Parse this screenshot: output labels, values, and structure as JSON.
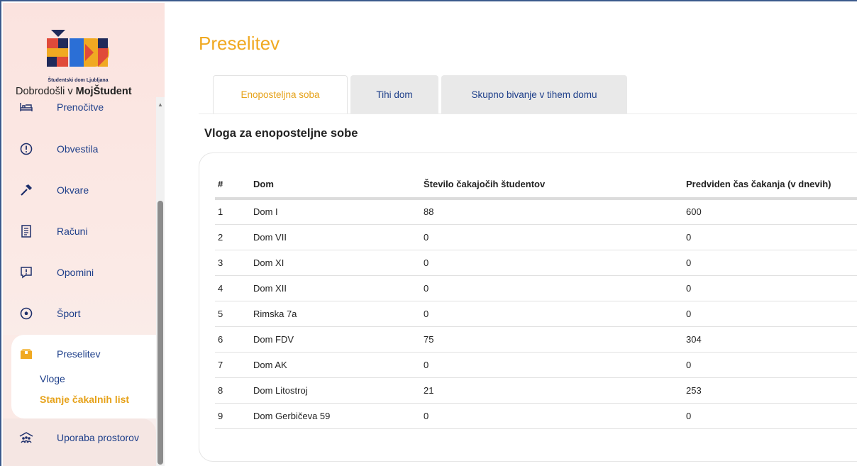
{
  "brand": {
    "caption": "Študentski dom Ljubljana",
    "colors": {
      "navy": "#1f2a5a",
      "red": "#e04a3a",
      "orange": "#f0a922",
      "blue": "#2b6fd6"
    }
  },
  "sidebar": {
    "welcome_prefix": "Dobrodošli v ",
    "welcome_app": "MojŠtudent",
    "items": [
      {
        "label": "Prenočitve",
        "icon": "bed-icon"
      },
      {
        "label": "Obvestila",
        "icon": "alert-circle-icon"
      },
      {
        "label": "Okvare",
        "icon": "hammer-icon"
      },
      {
        "label": "Računi",
        "icon": "receipt-icon"
      },
      {
        "label": "Opomini",
        "icon": "alert-message-icon"
      },
      {
        "label": "Šport",
        "icon": "soccer-ball-icon"
      },
      {
        "label": "Preselitev",
        "icon": "box-icon"
      },
      {
        "label": "Uporaba prostorov",
        "icon": "group-icon"
      }
    ],
    "sub_items": [
      {
        "label": "Vloge"
      },
      {
        "label": "Stanje čakalnih list"
      }
    ]
  },
  "main": {
    "title": "Preselitev",
    "tabs": [
      {
        "label": "Enoposteljna soba",
        "active": true
      },
      {
        "label": "Tihi dom",
        "active": false
      },
      {
        "label": "Skupno bivanje v tihem domu",
        "active": false
      }
    ],
    "section_title": "Vloga za enoposteljne sobe",
    "table": {
      "headers": [
        "#",
        "Dom",
        "Število čakajočih študentov",
        "Predviden čas čakanja (v dnevih)"
      ],
      "rows": [
        [
          "1",
          "Dom I",
          "88",
          "600"
        ],
        [
          "2",
          "Dom VII",
          "0",
          "0"
        ],
        [
          "3",
          "Dom XI",
          "0",
          "0"
        ],
        [
          "4",
          "Dom XII",
          "0",
          "0"
        ],
        [
          "5",
          "Rimska 7a",
          "0",
          "0"
        ],
        [
          "6",
          "Dom FDV",
          "75",
          "304"
        ],
        [
          "7",
          "Dom AK",
          "0",
          "0"
        ],
        [
          "8",
          "Dom Litostroj",
          "21",
          "253"
        ],
        [
          "9",
          "Dom Gerbičeva 59",
          "0",
          "0"
        ]
      ]
    }
  },
  "colors": {
    "accent": "#f0a922",
    "link": "#1e3f8a",
    "sidebar_bg": "#fbe3df"
  }
}
